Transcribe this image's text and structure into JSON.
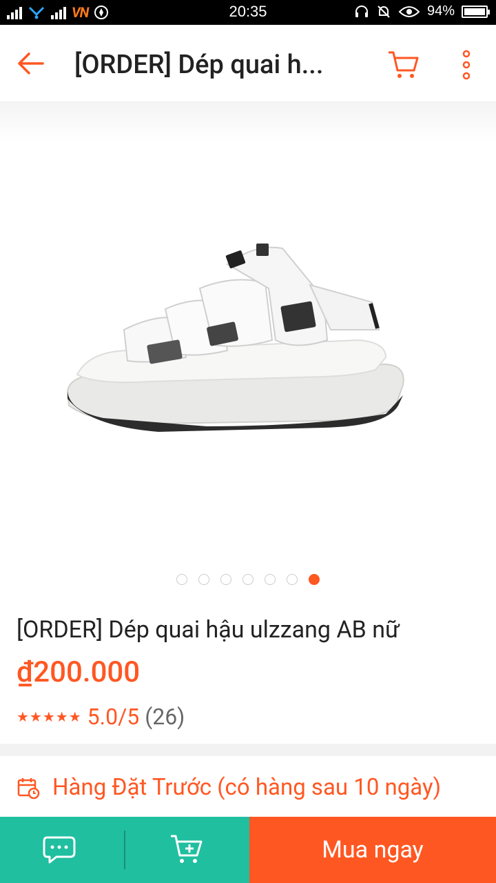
{
  "status_bar": {
    "time": "20:35",
    "battery": "94%",
    "carrier": "VN"
  },
  "app_bar": {
    "title": "[ORDER] Dép quai h..."
  },
  "gallery": {
    "image_description": "white strap sandal",
    "active_dot": 7,
    "total_dots": 7
  },
  "product": {
    "title": "[ORDER] Dép quai hậu ulzzang AB nữ",
    "price": "₫200.000",
    "rating_score": "5.0/5",
    "rating_count": "(26)",
    "stars": "★★★★★"
  },
  "shipping": {
    "preorder_text": "Hàng Đặt Trước (có hàng sau 10 ngày)"
  },
  "bottom_bar": {
    "buy_label": "Mua ngay"
  },
  "colors": {
    "accent": "#ff5722",
    "teal": "#1fbfa0"
  }
}
